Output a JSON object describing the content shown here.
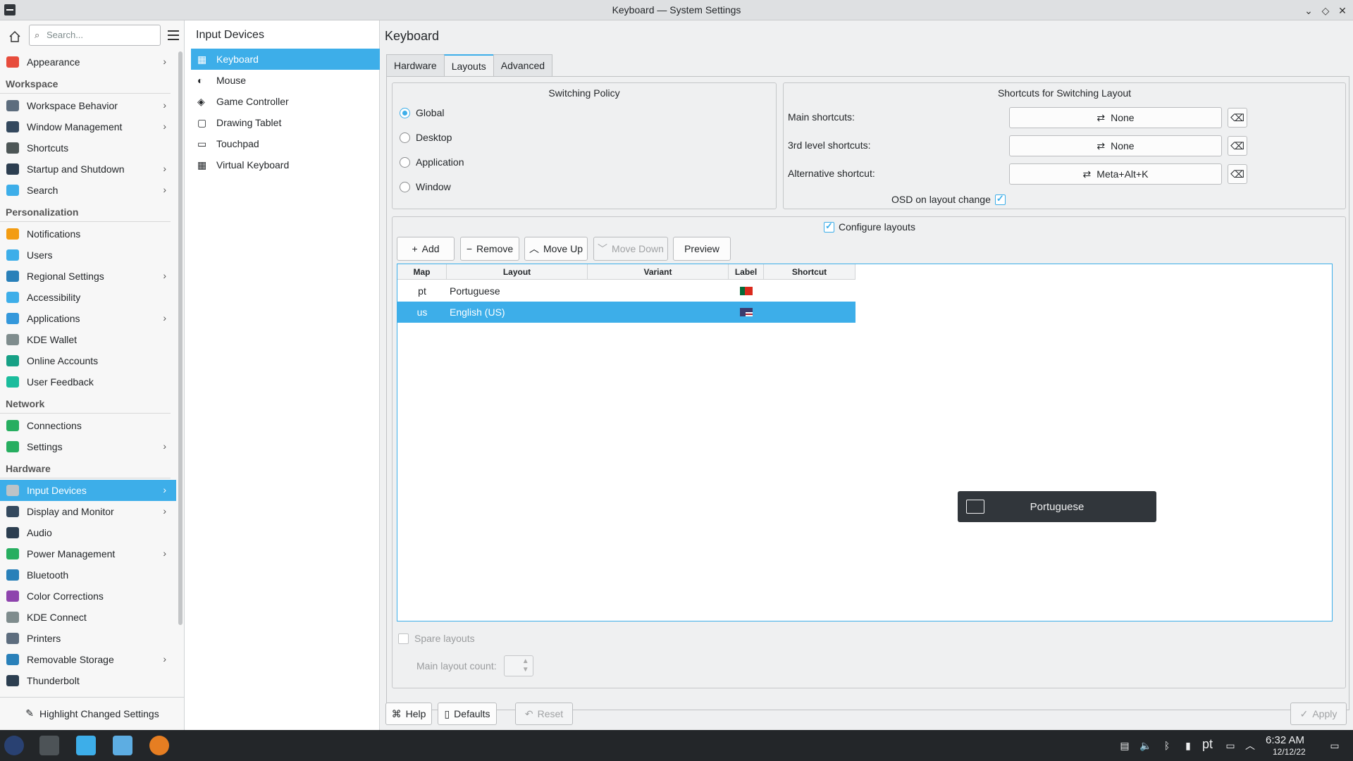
{
  "window": {
    "title": "Keyboard — System Settings"
  },
  "sidebar": {
    "search_placeholder": "Search...",
    "items": [
      {
        "type": "item",
        "label": "Appearance",
        "chevron": true,
        "color": "#e74c3c"
      },
      {
        "type": "cat",
        "label": "Workspace"
      },
      {
        "type": "item",
        "label": "Workspace Behavior",
        "chevron": true,
        "color": "#5d6d7e"
      },
      {
        "type": "item",
        "label": "Window Management",
        "chevron": true,
        "color": "#34495e"
      },
      {
        "type": "item",
        "label": "Shortcuts",
        "chevron": false,
        "color": "#4d5656"
      },
      {
        "type": "item",
        "label": "Startup and Shutdown",
        "chevron": true,
        "color": "#2c3e50"
      },
      {
        "type": "item",
        "label": "Search",
        "chevron": true,
        "color": "#3daee9"
      },
      {
        "type": "cat",
        "label": "Personalization"
      },
      {
        "type": "item",
        "label": "Notifications",
        "chevron": false,
        "color": "#f39c12"
      },
      {
        "type": "item",
        "label": "Users",
        "chevron": false,
        "color": "#3daee9"
      },
      {
        "type": "item",
        "label": "Regional Settings",
        "chevron": true,
        "color": "#2980b9"
      },
      {
        "type": "item",
        "label": "Accessibility",
        "chevron": false,
        "color": "#3daee9"
      },
      {
        "type": "item",
        "label": "Applications",
        "chevron": true,
        "color": "#3498db"
      },
      {
        "type": "item",
        "label": "KDE Wallet",
        "chevron": false,
        "color": "#7f8c8d"
      },
      {
        "type": "item",
        "label": "Online Accounts",
        "chevron": false,
        "color": "#16a085"
      },
      {
        "type": "item",
        "label": "User Feedback",
        "chevron": false,
        "color": "#1abc9c"
      },
      {
        "type": "cat",
        "label": "Network"
      },
      {
        "type": "item",
        "label": "Connections",
        "chevron": false,
        "color": "#27ae60"
      },
      {
        "type": "item",
        "label": "Settings",
        "chevron": true,
        "color": "#27ae60"
      },
      {
        "type": "cat",
        "label": "Hardware"
      },
      {
        "type": "item",
        "label": "Input Devices",
        "chevron": true,
        "active": true,
        "color": "#bdc3c7"
      },
      {
        "type": "item",
        "label": "Display and Monitor",
        "chevron": true,
        "color": "#34495e"
      },
      {
        "type": "item",
        "label": "Audio",
        "chevron": false,
        "color": "#2c3e50"
      },
      {
        "type": "item",
        "label": "Power Management",
        "chevron": true,
        "color": "#27ae60"
      },
      {
        "type": "item",
        "label": "Bluetooth",
        "chevron": false,
        "color": "#2980b9"
      },
      {
        "type": "item",
        "label": "Color Corrections",
        "chevron": false,
        "color": "#8e44ad"
      },
      {
        "type": "item",
        "label": "KDE Connect",
        "chevron": false,
        "color": "#7f8c8d"
      },
      {
        "type": "item",
        "label": "Printers",
        "chevron": false,
        "color": "#5d6d7e"
      },
      {
        "type": "item",
        "label": "Removable Storage",
        "chevron": true,
        "color": "#2980b9"
      },
      {
        "type": "item",
        "label": "Thunderbolt",
        "chevron": false,
        "color": "#2c3e50"
      }
    ],
    "highlight_label": "Highlight Changed Settings"
  },
  "middle": {
    "title": "Input Devices",
    "items": [
      {
        "label": "Keyboard",
        "active": true
      },
      {
        "label": "Mouse"
      },
      {
        "label": "Game Controller"
      },
      {
        "label": "Drawing Tablet"
      },
      {
        "label": "Touchpad"
      },
      {
        "label": "Virtual Keyboard"
      }
    ]
  },
  "main": {
    "title": "Keyboard",
    "tabs": [
      "Hardware",
      "Layouts",
      "Advanced"
    ],
    "active_tab": "Layouts",
    "switching_policy": {
      "title": "Switching Policy",
      "options": [
        "Global",
        "Desktop",
        "Application",
        "Window"
      ],
      "selected": "Global"
    },
    "shortcuts": {
      "title": "Shortcuts for Switching Layout",
      "rows": [
        {
          "label": "Main shortcuts:",
          "value": "None"
        },
        {
          "label": "3rd level shortcuts:",
          "value": "None"
        },
        {
          "label": "Alternative shortcut:",
          "value": "Meta+Alt+K"
        }
      ],
      "osd_label": "OSD on layout change",
      "osd_checked": true
    },
    "configure_layouts_label": "Configure layouts",
    "toolbar": {
      "add": "Add",
      "remove": "Remove",
      "move_up": "Move Up",
      "move_down": "Move Down",
      "preview": "Preview"
    },
    "table": {
      "columns": [
        "Map",
        "Layout",
        "Variant",
        "Label",
        "Shortcut"
      ],
      "rows": [
        {
          "map": "pt",
          "layout": "Portuguese",
          "variant": "",
          "flag": "pt",
          "shortcut": ""
        },
        {
          "map": "us",
          "layout": "English (US)",
          "variant": "",
          "flag": "us",
          "shortcut": "",
          "selected": true
        }
      ]
    },
    "spare_layouts_label": "Spare layouts",
    "main_layout_count_label": "Main layout count:",
    "osd_popup": "Portuguese",
    "bottom": {
      "help": "Help",
      "defaults": "Defaults",
      "reset": "Reset",
      "apply": "Apply"
    }
  },
  "taskbar": {
    "layout_indicator": "pt",
    "time": "6:32 AM",
    "date": "12/12/22"
  }
}
